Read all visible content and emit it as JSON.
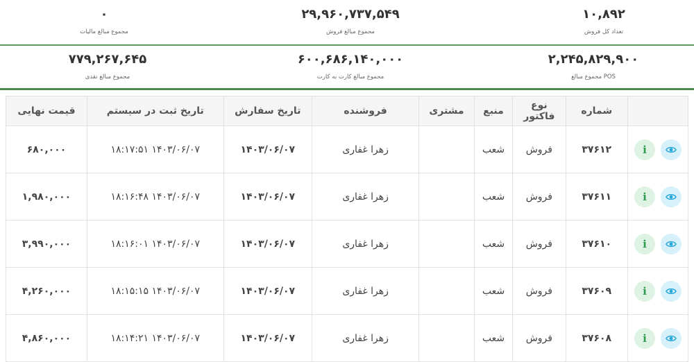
{
  "summary": {
    "row1": [
      {
        "value": "۱۰,۸۹۲",
        "label": "تعداد کل فروش"
      },
      {
        "value": "۲۹,۹۶۰,۷۳۷,۵۴۹",
        "label": "مجموع مبالغ فروش"
      },
      {
        "value": "۰",
        "label": "مجموع مبالغ مالیات"
      }
    ],
    "row2": [
      {
        "value": "۲,۲۴۵,۸۲۹,۹۰۰",
        "label": "مجموع مبالغ POS"
      },
      {
        "value": "۶۰۰,۶۸۶,۱۴۰,۰۰۰",
        "label": "مجموع مبالغ کارت به کارت"
      },
      {
        "value": "۷۷۹,۲۶۷,۶۴۵",
        "label": "مجموع مبالغ نقدی"
      }
    ]
  },
  "table": {
    "headers": {
      "number": "شماره",
      "invoice_type": "نوع فاکتور",
      "source": "منبع",
      "customer": "مشتری",
      "seller": "فروشنده",
      "order_date": "تاریخ سفارش",
      "system_date": "تاریخ ثبت در سیستم",
      "final_price": "قیمت نهایی"
    },
    "rows": [
      {
        "number": "۳۷۶۱۲",
        "invoice_type": "فروش",
        "source": "شعب",
        "customer": "",
        "seller": "زهرا غفاری",
        "order_date": "۱۴۰۳/۰۶/۰۷",
        "system_date": "۱۴۰۳/۰۶/۰۷ ۱۸:۱۷:۵۱",
        "final_price": "۶۸۰,۰۰۰"
      },
      {
        "number": "۳۷۶۱۱",
        "invoice_type": "فروش",
        "source": "شعب",
        "customer": "",
        "seller": "زهرا غفاری",
        "order_date": "۱۴۰۳/۰۶/۰۷",
        "system_date": "۱۴۰۳/۰۶/۰۷ ۱۸:۱۶:۴۸",
        "final_price": "۱,۹۸۰,۰۰۰"
      },
      {
        "number": "۳۷۶۱۰",
        "invoice_type": "فروش",
        "source": "شعب",
        "customer": "",
        "seller": "زهرا غفاری",
        "order_date": "۱۴۰۳/۰۶/۰۷",
        "system_date": "۱۴۰۳/۰۶/۰۷ ۱۸:۱۶:۰۱",
        "final_price": "۳,۹۹۰,۰۰۰"
      },
      {
        "number": "۳۷۶۰۹",
        "invoice_type": "فروش",
        "source": "شعب",
        "customer": "",
        "seller": "زهرا غفاری",
        "order_date": "۱۴۰۳/۰۶/۰۷",
        "system_date": "۱۴۰۳/۰۶/۰۷ ۱۸:۱۵:۱۵",
        "final_price": "۴,۲۶۰,۰۰۰"
      },
      {
        "number": "۳۷۶۰۸",
        "invoice_type": "فروش",
        "source": "شعب",
        "customer": "",
        "seller": "زهرا غفاری",
        "order_date": "۱۴۰۳/۰۶/۰۷",
        "system_date": "۱۴۰۳/۰۶/۰۷ ۱۸:۱۴:۲۱",
        "final_price": "۴,۸۶۰,۰۰۰"
      }
    ]
  },
  "icons": {
    "view": "eye-icon",
    "info": "info-icon"
  },
  "colors": {
    "accent_green": "#4b8b4b",
    "view_bg": "#d7f1fb",
    "view_fg": "#29a7d6",
    "info_bg": "#dff3e4",
    "info_fg": "#2e9b4e"
  }
}
